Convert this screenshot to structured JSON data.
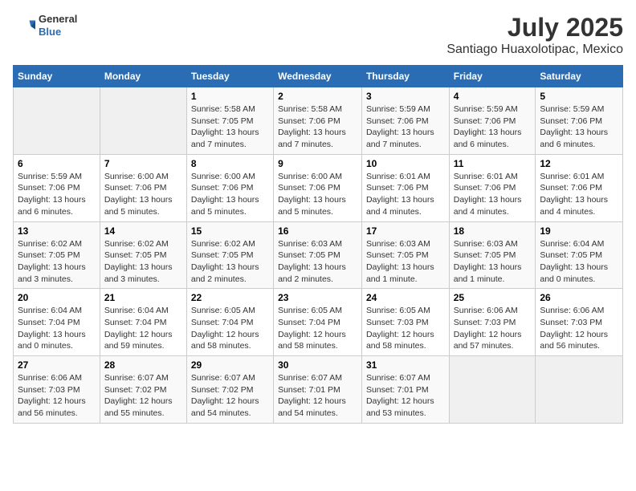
{
  "header": {
    "logo_line1": "General",
    "logo_line2": "Blue",
    "title": "July 2025",
    "subtitle": "Santiago Huaxolotipac, Mexico"
  },
  "weekdays": [
    "Sunday",
    "Monday",
    "Tuesday",
    "Wednesday",
    "Thursday",
    "Friday",
    "Saturday"
  ],
  "weeks": [
    [
      {
        "num": "",
        "info": ""
      },
      {
        "num": "",
        "info": ""
      },
      {
        "num": "1",
        "info": "Sunrise: 5:58 AM\nSunset: 7:05 PM\nDaylight: 13 hours and 7 minutes."
      },
      {
        "num": "2",
        "info": "Sunrise: 5:58 AM\nSunset: 7:06 PM\nDaylight: 13 hours and 7 minutes."
      },
      {
        "num": "3",
        "info": "Sunrise: 5:59 AM\nSunset: 7:06 PM\nDaylight: 13 hours and 7 minutes."
      },
      {
        "num": "4",
        "info": "Sunrise: 5:59 AM\nSunset: 7:06 PM\nDaylight: 13 hours and 6 minutes."
      },
      {
        "num": "5",
        "info": "Sunrise: 5:59 AM\nSunset: 7:06 PM\nDaylight: 13 hours and 6 minutes."
      }
    ],
    [
      {
        "num": "6",
        "info": "Sunrise: 5:59 AM\nSunset: 7:06 PM\nDaylight: 13 hours and 6 minutes."
      },
      {
        "num": "7",
        "info": "Sunrise: 6:00 AM\nSunset: 7:06 PM\nDaylight: 13 hours and 5 minutes."
      },
      {
        "num": "8",
        "info": "Sunrise: 6:00 AM\nSunset: 7:06 PM\nDaylight: 13 hours and 5 minutes."
      },
      {
        "num": "9",
        "info": "Sunrise: 6:00 AM\nSunset: 7:06 PM\nDaylight: 13 hours and 5 minutes."
      },
      {
        "num": "10",
        "info": "Sunrise: 6:01 AM\nSunset: 7:06 PM\nDaylight: 13 hours and 4 minutes."
      },
      {
        "num": "11",
        "info": "Sunrise: 6:01 AM\nSunset: 7:06 PM\nDaylight: 13 hours and 4 minutes."
      },
      {
        "num": "12",
        "info": "Sunrise: 6:01 AM\nSunset: 7:06 PM\nDaylight: 13 hours and 4 minutes."
      }
    ],
    [
      {
        "num": "13",
        "info": "Sunrise: 6:02 AM\nSunset: 7:05 PM\nDaylight: 13 hours and 3 minutes."
      },
      {
        "num": "14",
        "info": "Sunrise: 6:02 AM\nSunset: 7:05 PM\nDaylight: 13 hours and 3 minutes."
      },
      {
        "num": "15",
        "info": "Sunrise: 6:02 AM\nSunset: 7:05 PM\nDaylight: 13 hours and 2 minutes."
      },
      {
        "num": "16",
        "info": "Sunrise: 6:03 AM\nSunset: 7:05 PM\nDaylight: 13 hours and 2 minutes."
      },
      {
        "num": "17",
        "info": "Sunrise: 6:03 AM\nSunset: 7:05 PM\nDaylight: 13 hours and 1 minute."
      },
      {
        "num": "18",
        "info": "Sunrise: 6:03 AM\nSunset: 7:05 PM\nDaylight: 13 hours and 1 minute."
      },
      {
        "num": "19",
        "info": "Sunrise: 6:04 AM\nSunset: 7:05 PM\nDaylight: 13 hours and 0 minutes."
      }
    ],
    [
      {
        "num": "20",
        "info": "Sunrise: 6:04 AM\nSunset: 7:04 PM\nDaylight: 13 hours and 0 minutes."
      },
      {
        "num": "21",
        "info": "Sunrise: 6:04 AM\nSunset: 7:04 PM\nDaylight: 12 hours and 59 minutes."
      },
      {
        "num": "22",
        "info": "Sunrise: 6:05 AM\nSunset: 7:04 PM\nDaylight: 12 hours and 58 minutes."
      },
      {
        "num": "23",
        "info": "Sunrise: 6:05 AM\nSunset: 7:04 PM\nDaylight: 12 hours and 58 minutes."
      },
      {
        "num": "24",
        "info": "Sunrise: 6:05 AM\nSunset: 7:03 PM\nDaylight: 12 hours and 58 minutes."
      },
      {
        "num": "25",
        "info": "Sunrise: 6:06 AM\nSunset: 7:03 PM\nDaylight: 12 hours and 57 minutes."
      },
      {
        "num": "26",
        "info": "Sunrise: 6:06 AM\nSunset: 7:03 PM\nDaylight: 12 hours and 56 minutes."
      }
    ],
    [
      {
        "num": "27",
        "info": "Sunrise: 6:06 AM\nSunset: 7:03 PM\nDaylight: 12 hours and 56 minutes."
      },
      {
        "num": "28",
        "info": "Sunrise: 6:07 AM\nSunset: 7:02 PM\nDaylight: 12 hours and 55 minutes."
      },
      {
        "num": "29",
        "info": "Sunrise: 6:07 AM\nSunset: 7:02 PM\nDaylight: 12 hours and 54 minutes."
      },
      {
        "num": "30",
        "info": "Sunrise: 6:07 AM\nSunset: 7:01 PM\nDaylight: 12 hours and 54 minutes."
      },
      {
        "num": "31",
        "info": "Sunrise: 6:07 AM\nSunset: 7:01 PM\nDaylight: 12 hours and 53 minutes."
      },
      {
        "num": "",
        "info": ""
      },
      {
        "num": "",
        "info": ""
      }
    ]
  ]
}
